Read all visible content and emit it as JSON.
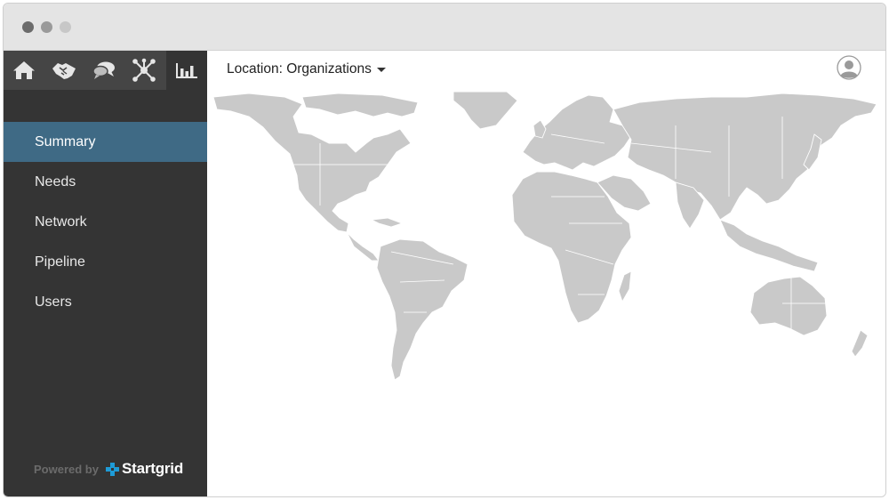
{
  "window": {
    "dots": [
      "#6b6b6b",
      "#9a9a9a",
      "#c7c7c7"
    ]
  },
  "toolbar": {
    "icons": [
      "home-icon",
      "handshake-icon",
      "chat-icon",
      "network-icon",
      "bar-chart-icon"
    ],
    "active_index": 4
  },
  "sidebar": {
    "items": [
      {
        "label": "Summary",
        "selected": true
      },
      {
        "label": "Needs",
        "selected": false
      },
      {
        "label": "Network",
        "selected": false
      },
      {
        "label": "Pipeline",
        "selected": false
      },
      {
        "label": "Users",
        "selected": false
      }
    ],
    "powered_by": "Powered by",
    "brand": "Startgrid",
    "brand_color": "#1e9bd7"
  },
  "header": {
    "location_label": "Location: Organizations"
  },
  "colors": {
    "sidebar_bg": "#343434",
    "selected_bg": "#3f6a85",
    "land": "#c9c9c9"
  }
}
